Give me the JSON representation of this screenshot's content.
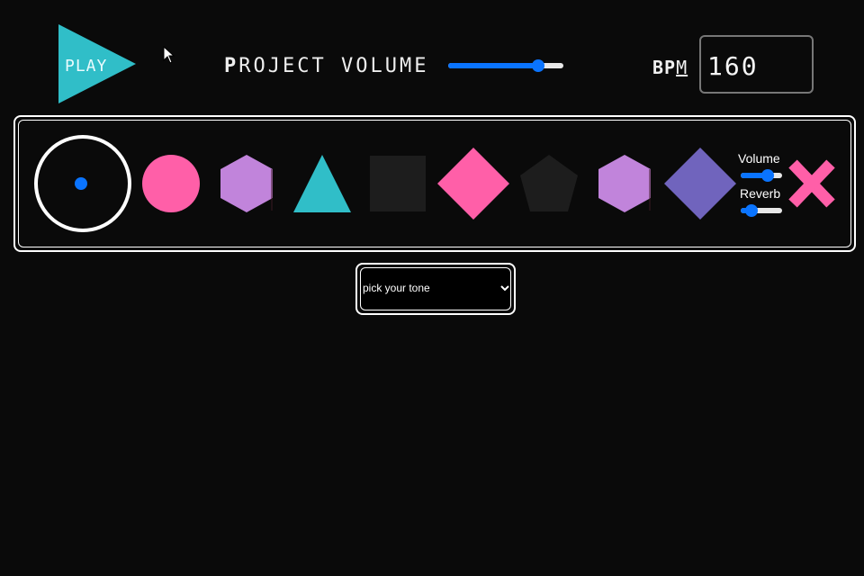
{
  "header": {
    "play_label": "PLAY",
    "project_volume": {
      "label_first_letter": "P",
      "label_rest_1": "ROJECT ",
      "label_rest_2": "VOLUME",
      "value": 0.78
    },
    "bpm": {
      "label_bold": "BP",
      "label_light": "M",
      "value": "160"
    }
  },
  "track": {
    "shapes": [
      {
        "name": "circle-outline",
        "color": "#ffffff",
        "active": true
      },
      {
        "name": "circle",
        "color": "#ff5fa8"
      },
      {
        "name": "hexagon",
        "color": "#c184db"
      },
      {
        "name": "triangle",
        "color": "#30bec8"
      },
      {
        "name": "square",
        "color": "#1d1d1d"
      },
      {
        "name": "diamond",
        "color": "#ff5fa8"
      },
      {
        "name": "pentagon",
        "color": "#1d1d1d"
      },
      {
        "name": "hexagon",
        "color": "#c184db"
      },
      {
        "name": "diamond",
        "color": "#7064bd"
      }
    ],
    "volume_label": "Volume",
    "reverb_label": "Reverb",
    "volume_value": 0.65,
    "reverb_value": 0.25,
    "delete_color": "#ff5fa8"
  },
  "tone_select": {
    "value": "pick your tone"
  },
  "colors": {
    "background": "#0a0a0a",
    "accent": "#0a74ff",
    "teal": "#30bec8"
  }
}
